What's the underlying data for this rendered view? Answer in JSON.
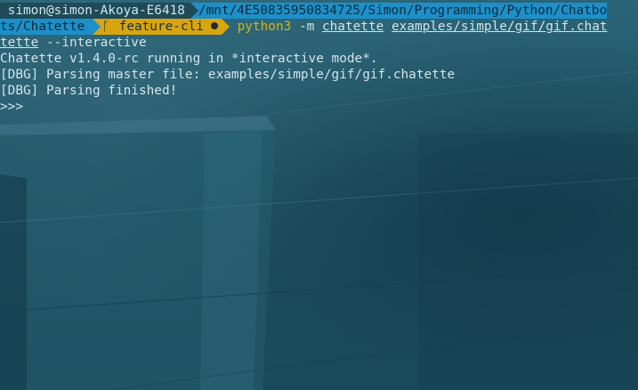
{
  "prompt": {
    "user_host": "simon@simon-Akoya-E6418",
    "path_line1": "/mnt/4E50835950834725/Simon/Programming/Python/Chatbo",
    "path_line2": "ts/Chatette",
    "branch_icon": "git-branch-icon",
    "branch_glyph": "ᚴ",
    "branch": "feature-cli",
    "colors": {
      "host_bg": "#1e4a5a",
      "path_bg": "#1d8fc9",
      "git_bg": "#d8a510",
      "command_fg": "#d3b416"
    }
  },
  "command": {
    "program": "python3",
    "flag": "-m",
    "module": "chatette",
    "arg": "examples/simple/gif/gif.chat",
    "continuation_underlined": "tette",
    "continuation_rest": " --interactive"
  },
  "output": {
    "line1": "Chatette v1.4.0-rc running in *interactive mode*.",
    "line2": "[DBG] Parsing master file: examples/simple/gif/gif.chatette",
    "line3": "[DBG] Parsing finished!",
    "repl_prompt": ">>>"
  }
}
